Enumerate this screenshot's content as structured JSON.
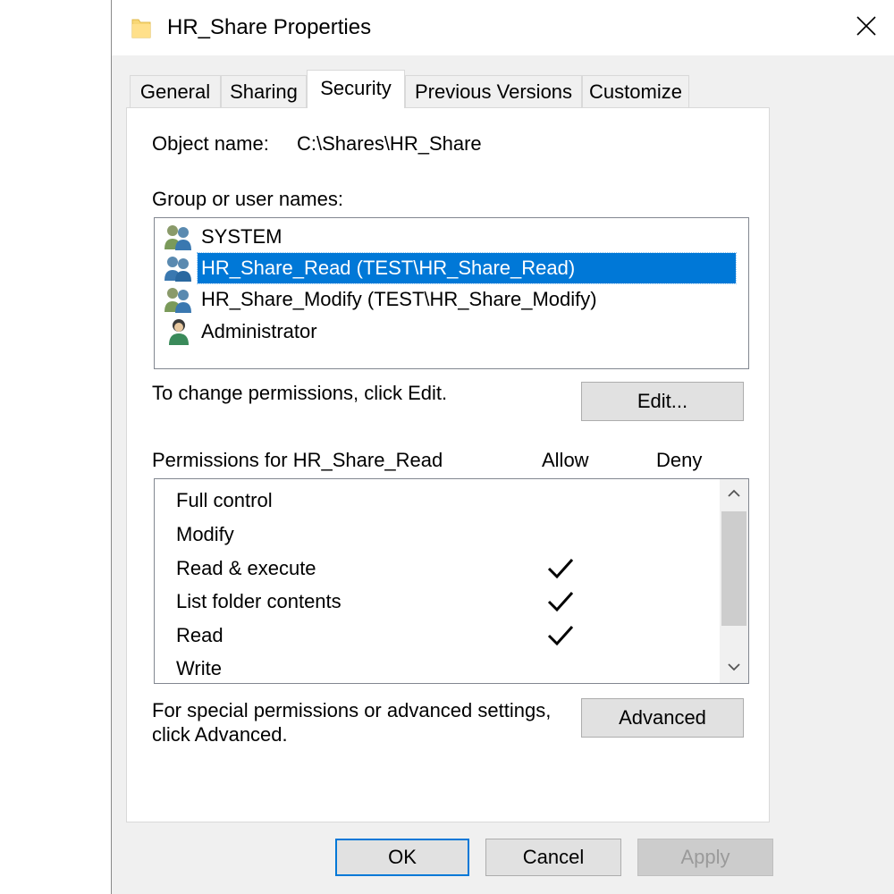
{
  "window": {
    "title": "HR_Share Properties",
    "icon": "folder-icon",
    "close_icon": "close-icon"
  },
  "tabs": [
    {
      "label": "General",
      "active": false
    },
    {
      "label": "Sharing",
      "active": false
    },
    {
      "label": "Security",
      "active": true
    },
    {
      "label": "Previous Versions",
      "active": false
    },
    {
      "label": "Customize",
      "active": false
    }
  ],
  "security": {
    "object_name_label": "Object name:",
    "object_name_value": "C:\\Shares\\HR_Share",
    "group_label": "Group or user names:",
    "users": [
      {
        "name": "SYSTEM",
        "icon": "group-icon",
        "selected": false
      },
      {
        "name": "HR_Share_Read (TEST\\HR_Share_Read)",
        "icon": "group-icon",
        "selected": true
      },
      {
        "name": "HR_Share_Modify (TEST\\HR_Share_Modify)",
        "icon": "group-icon",
        "selected": false
      },
      {
        "name": "Administrator",
        "icon": "user-icon",
        "selected": false
      }
    ],
    "change_text": "To change permissions, click Edit.",
    "edit_button": "Edit...",
    "permissions_header": "Permissions for HR_Share_Read",
    "allow_header": "Allow",
    "deny_header": "Deny",
    "permissions": [
      {
        "name": "Full control",
        "allow": false,
        "deny": false
      },
      {
        "name": "Modify",
        "allow": false,
        "deny": false
      },
      {
        "name": "Read & execute",
        "allow": true,
        "deny": false
      },
      {
        "name": "List folder contents",
        "allow": true,
        "deny": false
      },
      {
        "name": "Read",
        "allow": true,
        "deny": false
      },
      {
        "name": "Write",
        "allow": false,
        "deny": false
      }
    ],
    "advanced_text_line1": "For special permissions or advanced settings,",
    "advanced_text_line2": "click Advanced.",
    "advanced_button": "Advanced"
  },
  "footer": {
    "ok": "OK",
    "cancel": "Cancel",
    "apply": "Apply",
    "apply_enabled": false
  },
  "colors": {
    "selection": "#0078d7",
    "dialog_bg": "#f0f0f0",
    "button_bg": "#e1e1e1"
  }
}
